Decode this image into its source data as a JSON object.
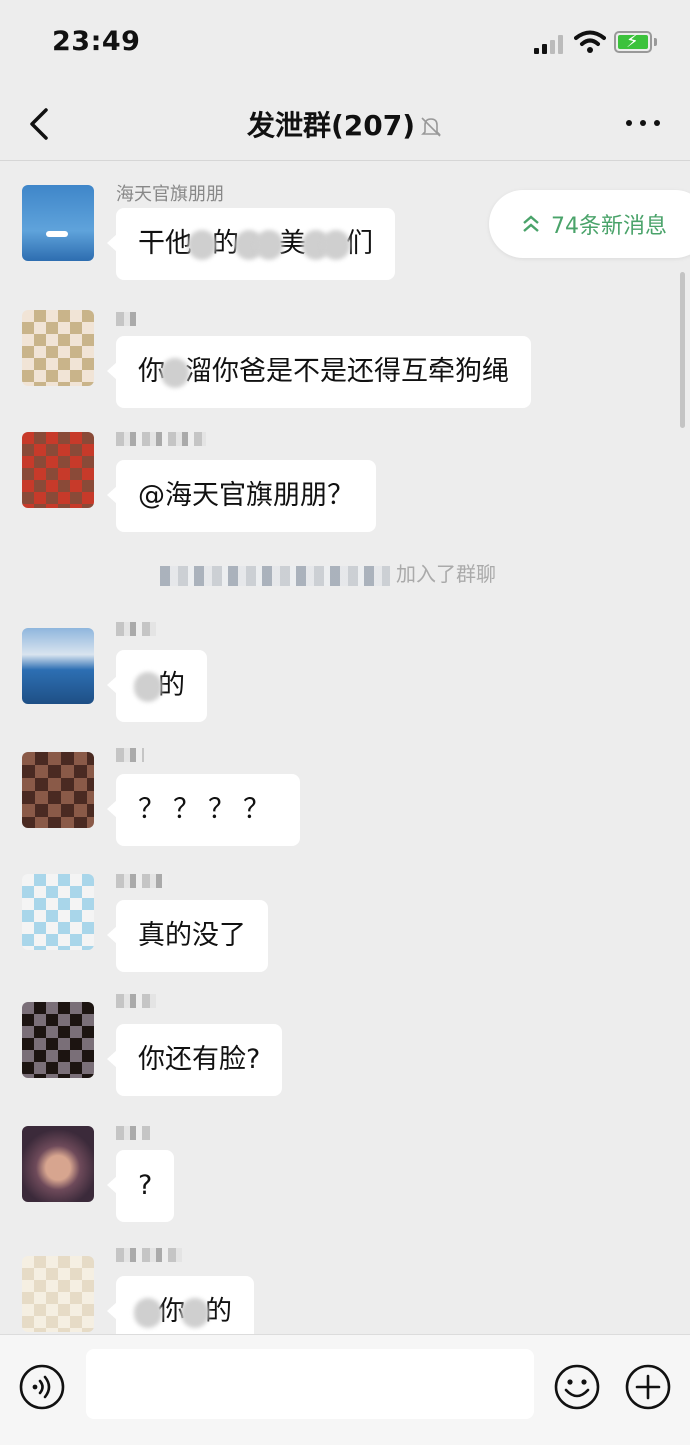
{
  "status_bar": {
    "time": "23:49"
  },
  "header": {
    "back_icon": "chevron-left-icon",
    "title": "发泄群(207)",
    "mute_icon": "bell-muted-icon",
    "more_icon": "more-dots-icon"
  },
  "new_messages_pill": {
    "label": "74条新消息",
    "icon": "double-chevron-up-icon"
  },
  "messages": [
    {
      "sender": "海天官旗朋朋",
      "parts": [
        "干他",
        "的",
        "美",
        "们"
      ]
    },
    {
      "parts": [
        "你",
        "溜你爸是不是还得互牵狗绳"
      ]
    },
    {
      "text": "@海天官旗朋朋？"
    },
    {
      "parts": [
        "",
        "的"
      ]
    },
    {
      "text": "？？？？"
    },
    {
      "text": "真的没了"
    },
    {
      "text": "你还有脸?"
    },
    {
      "text": "?"
    },
    {
      "parts": [
        "",
        "你",
        "的"
      ]
    }
  ],
  "system_message": {
    "suffix": "加入了群聊"
  },
  "input_bar": {
    "voice_icon": "voice-icon",
    "emoji_icon": "emoji-icon",
    "plus_icon": "plus-circle-icon"
  },
  "colors": {
    "background": "#ededed",
    "bubble": "#ffffff",
    "accent_green": "#4aa36a"
  }
}
